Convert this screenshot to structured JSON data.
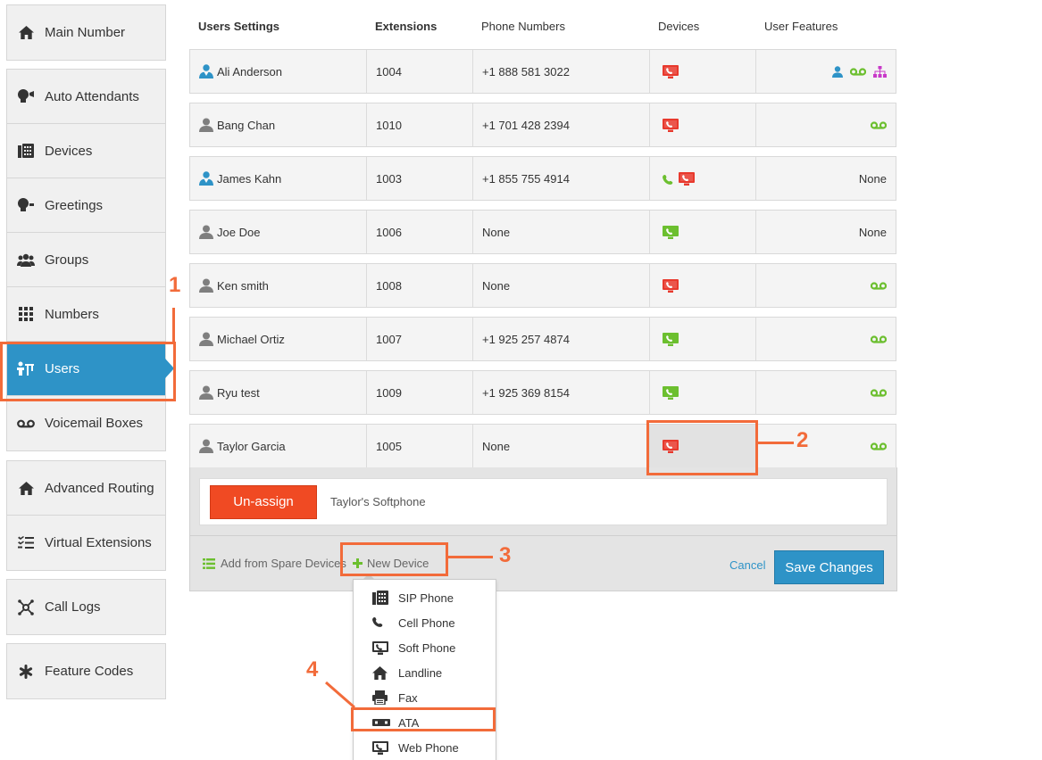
{
  "sidebar": {
    "groups": [
      [
        {
          "label": "Main Number",
          "icon": "home-icon"
        }
      ],
      [
        {
          "label": "Auto Attendants",
          "icon": "auto-attendant-icon"
        },
        {
          "label": "Devices",
          "icon": "fax-device-icon"
        },
        {
          "label": "Greetings",
          "icon": "greeting-icon"
        },
        {
          "label": "Groups",
          "icon": "group-icon"
        },
        {
          "label": "Numbers",
          "icon": "numbers-grid-icon"
        },
        {
          "label": "Users",
          "icon": "users-icon",
          "active": true
        },
        {
          "label": "Voicemail Boxes",
          "icon": "voicemail-icon"
        }
      ],
      [
        {
          "label": "Advanced Routing",
          "icon": "home-icon"
        },
        {
          "label": "Virtual Extensions",
          "icon": "checklist-icon"
        }
      ],
      [
        {
          "label": "Call Logs",
          "icon": "call-logs-icon"
        }
      ],
      [
        {
          "label": "Feature Codes",
          "icon": "asterisk-icon"
        }
      ]
    ]
  },
  "table": {
    "headers": {
      "users_settings": "Users Settings",
      "extensions": "Extensions",
      "phone_numbers": "Phone Numbers",
      "devices": "Devices",
      "user_features": "User Features"
    },
    "rows": [
      {
        "name": "Ali Anderson",
        "user_icon": "admin-user-icon",
        "ext": "1004",
        "phone": "+1 888 581 3022",
        "devices": [
          "softphone-red"
        ],
        "features": [
          "user-blue",
          "voicemail-green",
          "hierarchy-magenta"
        ]
      },
      {
        "name": "Bang Chan",
        "user_icon": "user-icon",
        "ext": "1010",
        "phone": "+1 701 428 2394",
        "devices": [
          "softphone-red"
        ],
        "features": [
          "voicemail-green"
        ]
      },
      {
        "name": "James Kahn",
        "user_icon": "admin-user-icon",
        "ext": "1003",
        "phone": "+1 855 755 4914",
        "devices": [
          "cellphone-green",
          "softphone-red"
        ],
        "features_text": "None"
      },
      {
        "name": "Joe Doe",
        "user_icon": "user-icon",
        "ext": "1006",
        "phone": "None",
        "devices": [
          "softphone-green"
        ],
        "features_text": "None"
      },
      {
        "name": "Ken smith",
        "user_icon": "user-icon",
        "ext": "1008",
        "phone": "None",
        "devices": [
          "softphone-red"
        ],
        "features": [
          "voicemail-green"
        ]
      },
      {
        "name": "Michael Ortiz",
        "user_icon": "user-icon",
        "ext": "1007",
        "phone": "+1 925 257 4874",
        "devices": [
          "softphone-green"
        ],
        "features": [
          "voicemail-green"
        ]
      },
      {
        "name": "Ryu test",
        "user_icon": "user-icon",
        "ext": "1009",
        "phone": "+1 925 369 8154",
        "devices": [
          "softphone-green"
        ],
        "features": [
          "voicemail-green"
        ]
      },
      {
        "name": "Taylor Garcia",
        "user_icon": "user-icon",
        "ext": "1005",
        "phone": "None",
        "devices": [
          "softphone-red"
        ],
        "features": [
          "voicemail-green"
        ],
        "expanded": true
      }
    ]
  },
  "expanded": {
    "unassign_label": "Un-assign",
    "device_label": "Taylor's Softphone",
    "add_spare_label": "Add from Spare Devices",
    "new_device_label": "New Device",
    "cancel_label": "Cancel",
    "save_label": "Save Changes"
  },
  "dropdown": {
    "items": [
      {
        "label": "SIP Phone",
        "icon": "sip-phone-icon"
      },
      {
        "label": "Cell Phone",
        "icon": "cell-phone-icon"
      },
      {
        "label": "Soft Phone",
        "icon": "soft-phone-icon"
      },
      {
        "label": "Landline",
        "icon": "landline-icon"
      },
      {
        "label": "Fax",
        "icon": "fax-icon"
      },
      {
        "label": "ATA",
        "icon": "ata-icon"
      },
      {
        "label": "Web Phone",
        "icon": "web-phone-icon"
      }
    ]
  },
  "callouts": [
    "1",
    "2",
    "3",
    "4"
  ],
  "colors": {
    "accent": "#2e93c7",
    "danger": "#f04a23",
    "callout": "#f26b3a",
    "device_red": "#e8392d",
    "device_green": "#6cbf2f",
    "feature_magenta": "#c838c8"
  }
}
